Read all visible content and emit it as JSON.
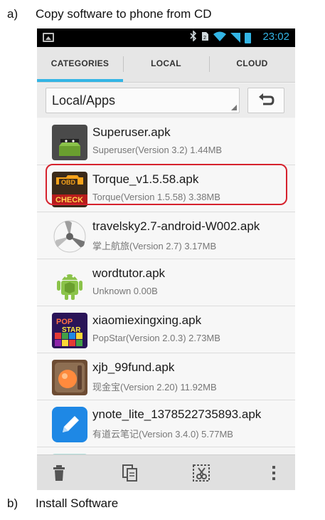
{
  "captions": {
    "a": {
      "letter": "a)",
      "text": "Copy software to phone from CD"
    },
    "b": {
      "letter": "b)",
      "text": "Install Software"
    }
  },
  "status_bar": {
    "time": "23:02",
    "icons": [
      "picture-icon",
      "bluetooth-icon",
      "sim-icon",
      "wifi-icon",
      "signal-icon",
      "battery-icon"
    ]
  },
  "tabs": [
    {
      "label": "CATEGORIES",
      "active": true
    },
    {
      "label": "LOCAL",
      "active": false
    },
    {
      "label": "CLOUD",
      "active": false
    }
  ],
  "path": {
    "current": "Local/Apps"
  },
  "files": [
    {
      "name": "Superuser.apk",
      "meta": "Superuser(Version 3.2) 1.44MB",
      "icon": "superuser-icon"
    },
    {
      "name": "Torque_v1.5.58.apk",
      "meta": "Torque(Version 1.5.58) 3.38MB",
      "icon": "torque-obd-icon",
      "highlighted": true
    },
    {
      "name": "travelsky2.7-android-W002.apk",
      "meta": "掌上航旅(Version 2.7) 3.17MB",
      "icon": "propeller-icon"
    },
    {
      "name": "wordtutor.apk",
      "meta": "Unknown 0.00B",
      "icon": "android-icon"
    },
    {
      "name": "xiaomiexingxing.apk",
      "meta": "PopStar(Version 2.0.3) 2.73MB",
      "icon": "popstar-icon"
    },
    {
      "name": "xjb_99fund.apk",
      "meta": "现金宝(Version 2.20) 11.92MB",
      "icon": "xianjinbao-icon"
    },
    {
      "name": "ynote_lite_1378522735893.apk",
      "meta": "有道云笔记(Version 3.4.0) 5.77MB",
      "icon": "ynote-icon"
    }
  ],
  "colors": {
    "accent": "#33b5e5",
    "highlight": "#d6222d",
    "status_bar": "#000000"
  },
  "bottom_bar": [
    "delete-icon",
    "copy-icon",
    "cut-icon",
    "overflow-menu-icon"
  ]
}
